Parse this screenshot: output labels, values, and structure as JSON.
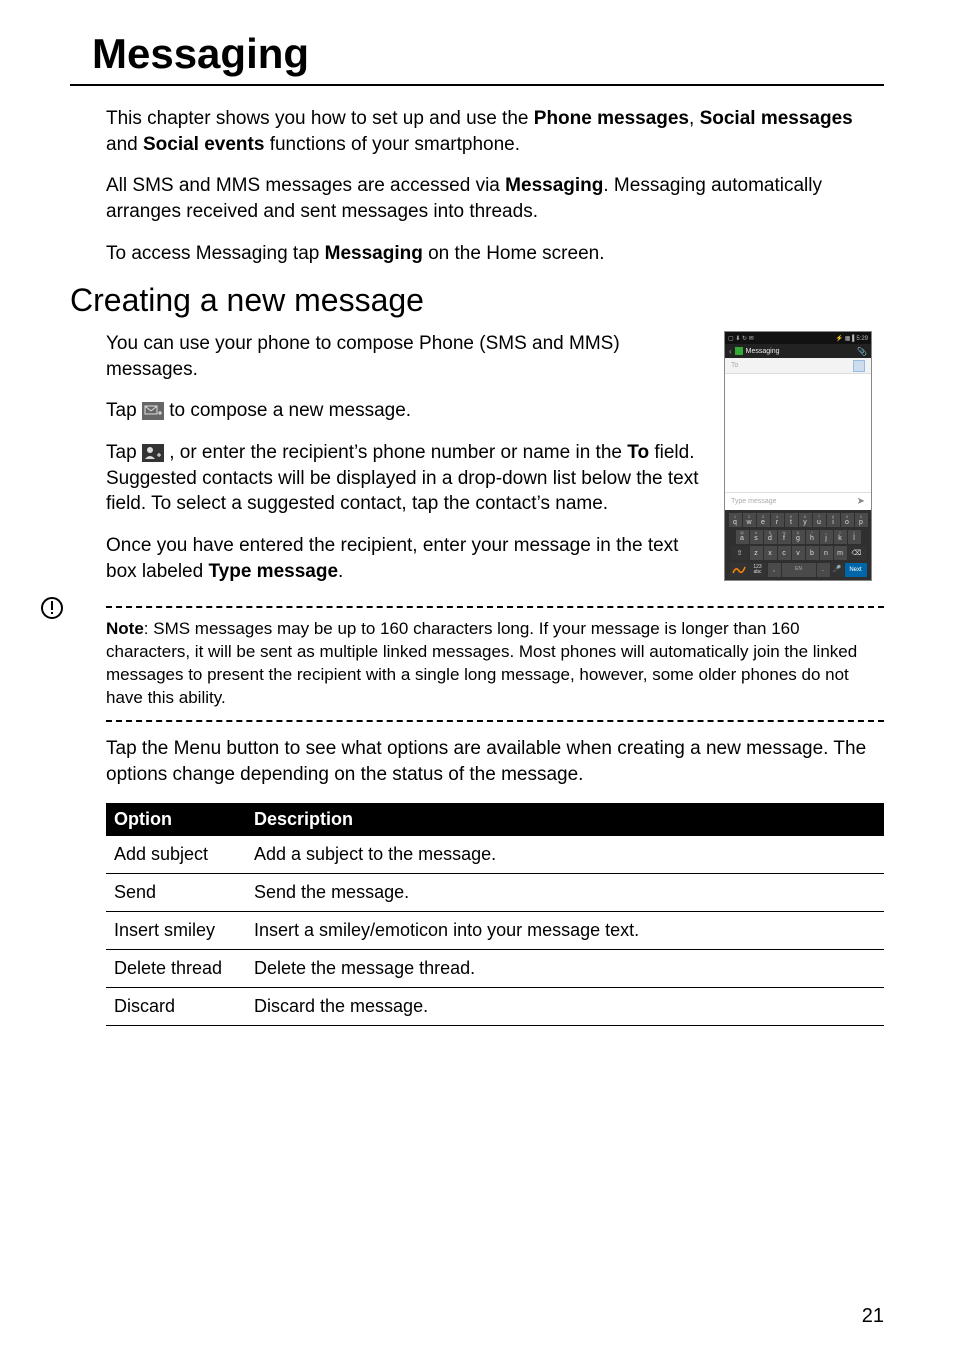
{
  "page": {
    "number": "21",
    "h1": "Messaging",
    "intro_1_pre": "This chapter shows you how to set up and use the ",
    "intro_1_b1": "Phone messages",
    "intro_1_mid1": ", ",
    "intro_1_b2": "Social messages",
    "intro_1_mid2": " and ",
    "intro_1_b3": "Social events",
    "intro_1_post": " functions of your smartphone.",
    "intro_2_pre": "All SMS and MMS messages are accessed via ",
    "intro_2_b": "Messaging",
    "intro_2_post": ". Messaging automatically arranges received and sent messages into threads.",
    "intro_3_pre": "To access Messaging tap ",
    "intro_3_b": "Messaging",
    "intro_3_post": " on the Home screen.",
    "h2": "Creating a new message",
    "create_1": "You can use your phone to compose Phone (SMS and MMS) messages.",
    "create_2_pre": "Tap ",
    "create_2_post": " to compose a new message.",
    "create_3_pre": "Tap ",
    "create_3_mid": ", or enter the recipient’s phone number or name in the ",
    "create_3_b": "To",
    "create_3_post": " field. Suggested contacts will be displayed in a drop-down list below the text field. To select a suggested contact, tap the contact’s name.",
    "create_4_pre": "Once you have entered the recipient, enter your message in the text box labeled ",
    "create_4_b": "Type message",
    "create_4_post": ".",
    "note_label": "Note",
    "note_body": ": SMS messages may be up to 160 characters long. If your message is longer than 160 characters, it will be sent as multiple linked messages. Most phones will automatically join the linked messages to present the recipient with a single long message, however, some older phones do not have this ability.",
    "options_intro": "Tap the Menu button to see what options are available when creating a new message. The options change depending on the status of the message.",
    "table": {
      "headers": {
        "option": "Option",
        "description": "Description"
      },
      "rows": [
        {
          "option": "Add subject",
          "description": "Add a subject to the message."
        },
        {
          "option": "Send",
          "description": "Send the message."
        },
        {
          "option": "Insert smiley",
          "description": "Insert a smiley/emoticon into your message text."
        },
        {
          "option": "Delete thread",
          "description": "Delete the message thread."
        },
        {
          "option": "Discard",
          "description": "Discard the message."
        }
      ]
    }
  },
  "phone_screenshot": {
    "status": {
      "left_icons": "▢ ⬇ ↻ ✉",
      "right": "⚡ ▦ ▌5:29"
    },
    "appbar": {
      "back": "‹",
      "title": "Messaging",
      "attach": "📎"
    },
    "to_field": {
      "placeholder": "To"
    },
    "type_field": {
      "placeholder": "Type message",
      "send": "➤"
    },
    "keyboard": {
      "row1_sup": [
        "1",
        "2",
        "3",
        "4",
        "5",
        "6",
        "7",
        "8",
        "9",
        "0"
      ],
      "row1": [
        "q",
        "w",
        "e",
        "r",
        "t",
        "y",
        "u",
        "i",
        "o",
        "p"
      ],
      "row2_sup": [
        "@",
        "#",
        "$",
        "%",
        "&",
        "*",
        "-",
        "+",
        "("
      ],
      "row2": [
        "a",
        "s",
        "d",
        "f",
        "g",
        "h",
        "j",
        "k",
        "l"
      ],
      "row3": [
        "z",
        "x",
        "c",
        "v",
        "b",
        "n",
        "m"
      ],
      "shift": "⇧",
      "backspace": "⌫",
      "sym": "123\nabc",
      "comma": ",",
      "space": "EN",
      "period": ".",
      "mic": "🎤",
      "next": "Next"
    }
  }
}
